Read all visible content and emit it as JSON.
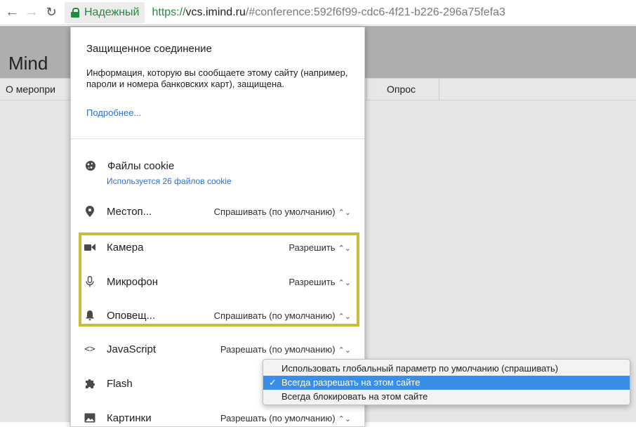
{
  "browser": {
    "back_icon": "arrow-left-icon",
    "forward_icon": "arrow-right-icon",
    "reload_icon": "reload-icon",
    "secure_label": "Надежный",
    "url_scheme": "https://",
    "url_host": "vcs.imind.ru",
    "url_rest": "/#conference:592f6f99-cdc6-4f21-b226-296a75fefa3"
  },
  "page": {
    "app_title": "Mind",
    "tab_about": "О меропри",
    "tab_poll": "Опрос"
  },
  "popup": {
    "title": "Защищенное соединение",
    "description": "Информация, которую вы сообщаете этому сайту (например, пароли и номера банковских карт), защищена.",
    "more_link": "Подробнее...",
    "cookies": {
      "label": "Файлы cookie",
      "sub": "Используется 26 файлов cookie"
    },
    "permissions": [
      {
        "label": "Местоп...",
        "value": "Спрашивать (по умолчанию)",
        "icon": "location-pin-icon"
      },
      {
        "label": "Камера",
        "value": "Разрешить",
        "icon": "camera-icon"
      },
      {
        "label": "Микрофон",
        "value": "Разрешить",
        "icon": "microphone-icon"
      },
      {
        "label": "Оповещ...",
        "value": "Спрашивать (по умолчанию)",
        "icon": "bell-icon"
      },
      {
        "label": "JavaScript",
        "value": "Разрешать (по умолчанию)",
        "icon": "code-icon"
      },
      {
        "label": "Flash",
        "value": "",
        "icon": "puzzle-icon"
      },
      {
        "label": "Картинки",
        "value": "Разрешать (по умолчанию)",
        "icon": "image-icon"
      }
    ]
  },
  "dropdown": {
    "options": [
      "Использовать глобальный параметр по умолчанию (спрашивать)",
      "Всегда разрешать на этом сайте",
      "Всегда блокировать на этом сайте"
    ],
    "selected_index": 1
  },
  "colors": {
    "secure_green": "#1e8e3e",
    "link_blue": "#2a6fd6",
    "highlight": "#c9bd3a",
    "menu_selected": "#3b8ee8"
  }
}
